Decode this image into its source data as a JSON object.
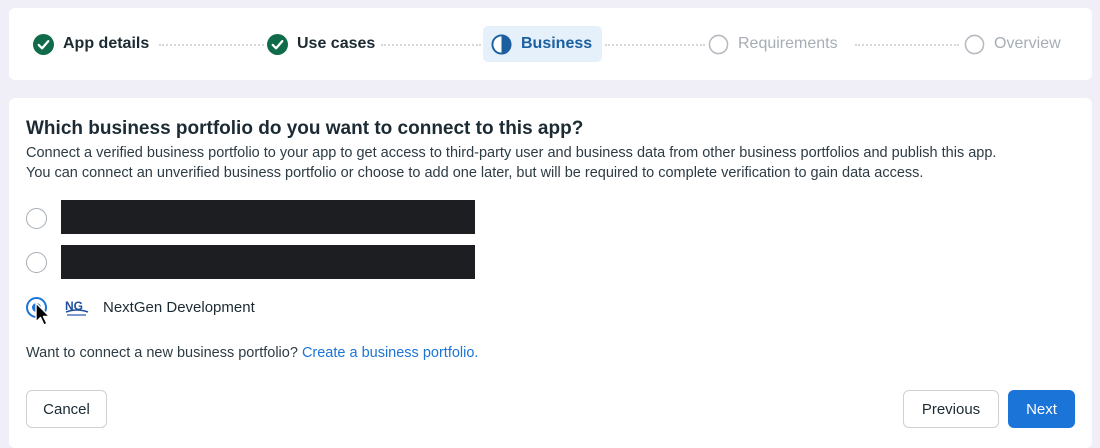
{
  "stepper": {
    "steps": [
      {
        "label": "App details",
        "state": "completed",
        "icon": "check-circle-icon"
      },
      {
        "label": "Use cases",
        "state": "completed",
        "icon": "check-circle-icon"
      },
      {
        "label": "Business",
        "state": "active",
        "icon": "half-circle-icon"
      },
      {
        "label": "Requirements",
        "state": "pending",
        "icon": "empty-circle-icon"
      },
      {
        "label": "Overview",
        "state": "pending",
        "icon": "empty-circle-icon"
      }
    ]
  },
  "main": {
    "title": "Which business portfolio do you want to connect to this app?",
    "description_line1": "Connect a verified business portfolio to your app to get access to third-party user and business data from other business portfolios and publish this app.",
    "description_line2": "You can connect an unverified business portfolio or choose to add one later, but will be required to complete verification to gain data access.",
    "options": [
      {
        "label": "",
        "redacted": true,
        "selected": false
      },
      {
        "label": "",
        "redacted": true,
        "selected": false
      },
      {
        "label": "NextGen Development",
        "redacted": false,
        "selected": true,
        "logo": "nextgen-logo"
      }
    ],
    "connect_prompt": "Want to connect a new business portfolio?",
    "connect_link": "Create a business portfolio."
  },
  "footer": {
    "cancel_label": "Cancel",
    "previous_label": "Previous",
    "next_label": "Next"
  },
  "colors": {
    "accent": "#1b74d8",
    "completed": "#0f6b4a",
    "active_bg": "#e6f0fb",
    "pending": "#a6adb4"
  }
}
